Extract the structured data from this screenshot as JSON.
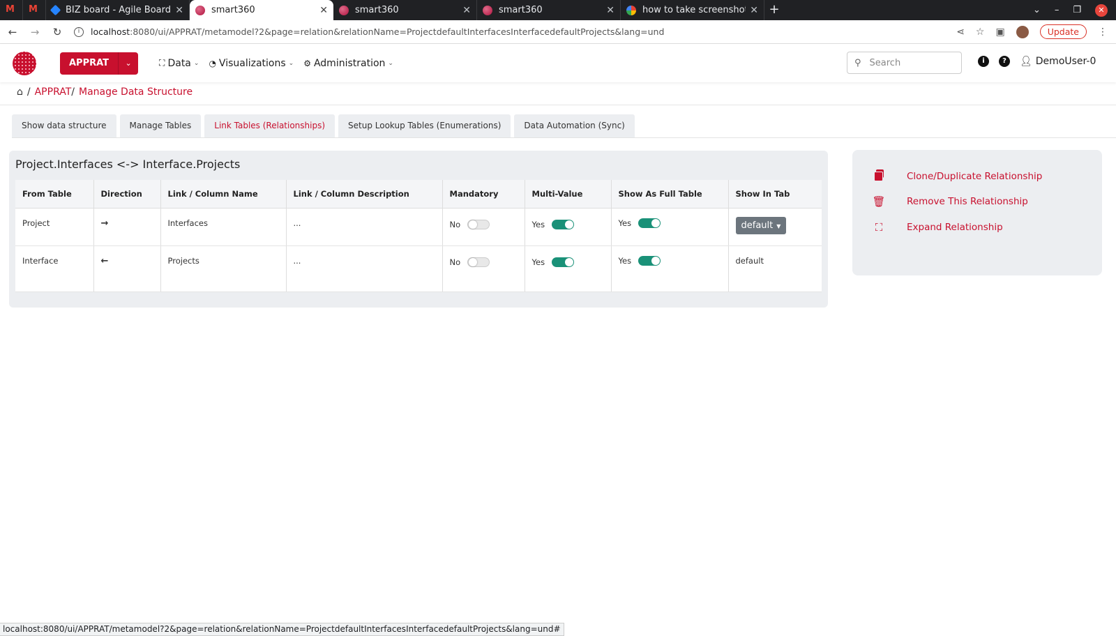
{
  "browser": {
    "tabs": [
      {
        "title": "BIZ board - Agile Board - J",
        "favicon": "jira-icon",
        "active": false
      },
      {
        "title": "smart360",
        "favicon": "smart360-icon",
        "active": true
      },
      {
        "title": "smart360",
        "favicon": "smart360-icon",
        "active": false
      },
      {
        "title": "smart360",
        "favicon": "smart360-icon",
        "active": false
      },
      {
        "title": "how to take screenshot in",
        "favicon": "google-icon",
        "active": false
      }
    ],
    "url_host": "localhost",
    "url_rest": ":8080/ui/APPRAT/metamodel?2&page=relation&relationName=ProjectdefaultInterfacesInterfacedefaultProjects&lang=und",
    "update_label": "Update"
  },
  "header": {
    "app_button": "APPRAT",
    "menu": [
      {
        "label": "Data",
        "icon": "sitemap-icon"
      },
      {
        "label": "Visualizations",
        "icon": "chart-pie-icon"
      },
      {
        "label": "Administration",
        "icon": "cogs-icon"
      }
    ],
    "search_placeholder": "Search",
    "user": "DemoUser-0"
  },
  "breadcrumb": {
    "sep": "/",
    "app": "APPRAT",
    "sep2": "/",
    "page": "Manage Data Structure"
  },
  "page_tabs": [
    {
      "label": "Show data structure",
      "active": false
    },
    {
      "label": "Manage Tables",
      "active": false
    },
    {
      "label": "Link Tables (Relationships)",
      "active": true
    },
    {
      "label": "Setup Lookup Tables (Enumerations)",
      "active": false
    },
    {
      "label": "Data Automation (Sync)",
      "active": false
    }
  ],
  "relationship": {
    "title": "Project.Interfaces <-> Interface.Projects",
    "columns": [
      "From Table",
      "Direction",
      "Link / Column Name",
      "Link / Column Description",
      "Mandatory",
      "Multi-Value",
      "Show As Full Table",
      "Show In Tab"
    ],
    "rows": [
      {
        "from": "Project",
        "direction": "→",
        "name": "Interfaces",
        "description": "...",
        "mandatory": "No",
        "multi": "Yes",
        "full_table": "Yes",
        "tab": "default"
      },
      {
        "from": "Interface",
        "direction": "←",
        "name": "Projects",
        "description": "...",
        "mandatory": "No",
        "multi": "Yes",
        "full_table": "Yes",
        "tab": "default"
      }
    ]
  },
  "actions": [
    {
      "label": "Clone/Duplicate Relationship",
      "icon": "copy-icon"
    },
    {
      "label": "Remove This Relationship",
      "icon": "trash-icon"
    },
    {
      "label": "Expand Relationship",
      "icon": "expand-icon"
    }
  ],
  "status_url": "localhost:8080/ui/APPRAT/metamodel?2&page=relation&relationName=ProjectdefaultInterfacesInterfacedefaultProjects&lang=und#",
  "colors": {
    "brand": "#c8102e",
    "toggle_on": "#1a9178",
    "panel_bg": "#eceef1"
  }
}
